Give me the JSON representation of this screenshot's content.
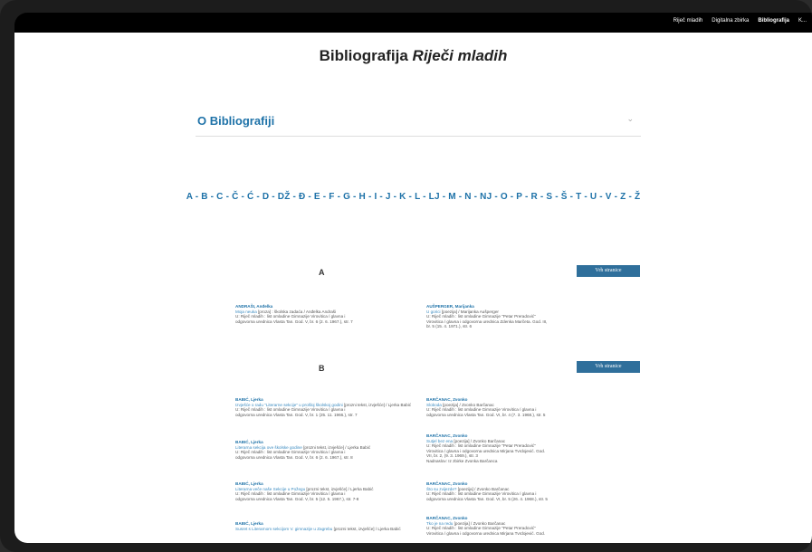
{
  "nav": {
    "items": [
      "Riječ mladih",
      "Digitalna zbirka",
      "Bibliografija",
      "K..."
    ],
    "active_index": 2
  },
  "header": {
    "title_prefix": "Bibliografija",
    "title_italic": "Riječi mladih"
  },
  "about": {
    "title": "O Bibliografiji"
  },
  "alphabet": "A - B - C - Č - Ć - D - DŽ - Đ - E - F - G - H - I - J - K - L - LJ - M - N - NJ - O - P - R - S - Š - T - U - V - Z - Ž",
  "top_button_label": "Vrh stranice",
  "sections": {
    "A": {
      "letter": "A",
      "entries": [
        {
          "author": "ANDRAŠI, Anđelka",
          "title": "Moja neuka",
          "rest": "[proza] : školska zadaća / Anđelka Andraši",
          "l1": "U: Riječ mladih : list omladine Gimnazije Virovitica / glavna i",
          "l2": "odgovorna urednica Vlasta Tan. God. V, br. 6 (2. 6. 1967.), str. 7"
        },
        {
          "author": "AUŠPERGER, Marijanka",
          "title": "U gorici",
          "rest": "[poezija] / Marijanka Aušperger",
          "l1": "U: Riječ mladih : list omladine Gimnazije \"Petar Preradović\"",
          "l2": "Virovitica / glavna i odgovorna urednica Zdenka Marčeta. God. III,",
          "l3": "br. 5 (15. 4. 1971.), str. 6"
        }
      ]
    },
    "B": {
      "letter": "B",
      "entries": [
        {
          "author": "BABIĆ, Ljerka",
          "title": "Izvješće o radu \"Literarne sekcije\" u prošloj školskoj godini",
          "rest": "[prozni tekst, izvješće] / Ljerka Babić",
          "l1": "U: Riječ mladih : list omladine Gimnazije Virovitica / glavna i",
          "l2": "odgovorna urednica Vlasta Tan. God. V, br. 1 (25. 11. 1966.), str. 7"
        },
        {
          "author": "BARČANAC, Zvonko",
          "title": "Sloboda",
          "rest": "[poezija] / Zvonko Barčanac",
          "l1": "U: Riječ mladih : list omladine Gimnazije Virovitica / glavna i",
          "l2": "odgovorna urednica Vlasta Tan. God. VI, br. 4 (7. 3. 1968.), str. 5"
        },
        {
          "author": "BABIĆ, Ljerka",
          "title": "Literarna sekcija ove školske godine",
          "rest": "[prozni tekst, izvješće] / Ljerka Babić",
          "l1": "U: Riječ mladih : list omladine Gimnazije Virovitica / glavna i",
          "l2": "odgovorna urednica Vlasta Tan. God. V, br. 6 (2. 6. 1967.), str. 8"
        },
        {
          "author": "BARČANAC, Zvonko",
          "title": "Sutjel bez ena",
          "rest": "[poezija] / Zvonko Barčanac",
          "l1": "U: Riječ mladih : list omladine Gimnazije \"Petar Preradović\"",
          "l2": "Virovitica / glavna i odgovorna urednica Mirjana Tvrdojević. God.",
          "l3": "VII, br. 2, (9. 3. 1969.), str. 3",
          "l4": "Nadnaslov: Iz zbirke Zvonka Barčanca"
        },
        {
          "author": "BABIĆ, Ljerka",
          "title": "Literarna veče naše Sekcije u Požegu",
          "rest": "[prozni tekst, izvješće] / Ljerka Babić",
          "l1": "U: Riječ mladih : list omladine Gimnazije Virovitica / glavna i",
          "l2": "odgovorna urednica Vlasta Tan. God. V, br. 5 (12. 5. 1967.), str. 7-8"
        },
        {
          "author": "BARČANAC, Zvonko",
          "title": "Što su zvijezde?",
          "rest": "[poezija] / Zvonko Barčanac",
          "l1": "U: Riječ mladih : list omladine Gimnazije Virovitica / glavna i",
          "l2": "odgovorna urednica Vlasta Tan. God. VI, br. 5 (26. 4. 1968.), str. 5"
        },
        {
          "author": "BABIĆ, Ljerka",
          "title": "Susret s Literarnom sekcijom V. gimnazije u Zagrebu",
          "rest": "[prozni tekst, izvješće] / Ljerka Babić",
          "l1": ""
        },
        {
          "author": "BARČANAC, Zvonko",
          "title": "Tko je na redu",
          "rest": "[poezija] / Zvonko Barčanac",
          "l1": "U: Riječ mladih : list omladine Gimnazije \"Petar Preradović\"",
          "l2": "Virovitica / glavna i odgovorna urednica Mirjana Tvrdojević. God."
        }
      ]
    }
  }
}
